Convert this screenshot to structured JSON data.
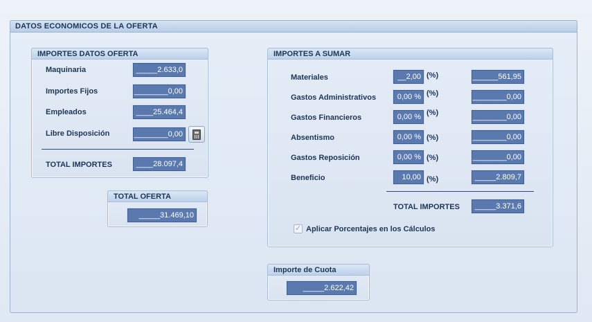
{
  "section_title": "DATOS ECONOMICOS DE LA OFERTA",
  "importes_datos_oferta": {
    "title": "IMPORTES DATOS OFERTA",
    "rows": [
      {
        "label": "Maquinaria",
        "value": "_____2.633,0"
      },
      {
        "label": "Importes Fijos",
        "value": "________0,00"
      },
      {
        "label": "Empleados",
        "value": "____25.464,4"
      },
      {
        "label": "Libre Disposición",
        "value": "________0,00"
      }
    ],
    "total_label": "TOTAL IMPORTES",
    "total_value": "____28.097,4",
    "calculator_icon": "calculator-icon"
  },
  "total_oferta": {
    "title": "TOTAL OFERTA",
    "value": "_____31.469,10"
  },
  "importes_a_sumar": {
    "title": "IMPORTES A SUMAR",
    "rows": [
      {
        "label": "Materiales",
        "percent": "__2,00",
        "unit": "(%)",
        "value": "______561,95"
      },
      {
        "label": "Gastos Administrativos",
        "percent": "0,00 %",
        "unit": "(%)",
        "value": "________0,00"
      },
      {
        "label": "Gastos Financieros",
        "percent": "0,00 %",
        "unit": "(%)",
        "value": "________0,00"
      },
      {
        "label": "Absentismo",
        "percent": "0,00 %",
        "unit": "(%)",
        "value": "________0,00"
      },
      {
        "label": "Gastos Reposición",
        "percent": "0,00 %",
        "unit": "(%)",
        "value": "________0,00"
      },
      {
        "label": "Beneficio",
        "percent": "10,00",
        "unit": "(%)",
        "value": "_____2.809,7"
      }
    ],
    "total_label": "TOTAL IMPORTES",
    "total_value": "_____3.371,6",
    "checkbox_label": "Aplicar Porcentajes en los Cálculos",
    "checkbox_checked": true
  },
  "importe_cuota": {
    "title": "Importe de Cuota",
    "value": "_____2.622,42"
  }
}
